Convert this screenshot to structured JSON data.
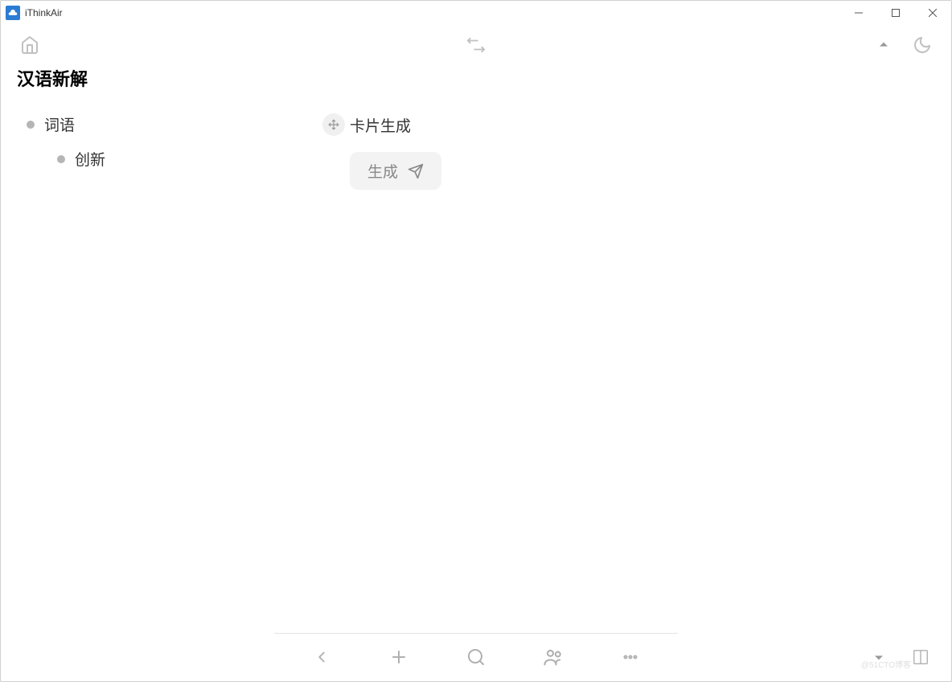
{
  "window": {
    "title": "iThinkAir"
  },
  "page": {
    "title": "汉语新解"
  },
  "tree": {
    "items": [
      {
        "label": "词语",
        "level": 1
      },
      {
        "label": "创新",
        "level": 2
      }
    ]
  },
  "card": {
    "title": "卡片生成",
    "generate_label": "生成"
  },
  "watermark": "@51CTO博客"
}
